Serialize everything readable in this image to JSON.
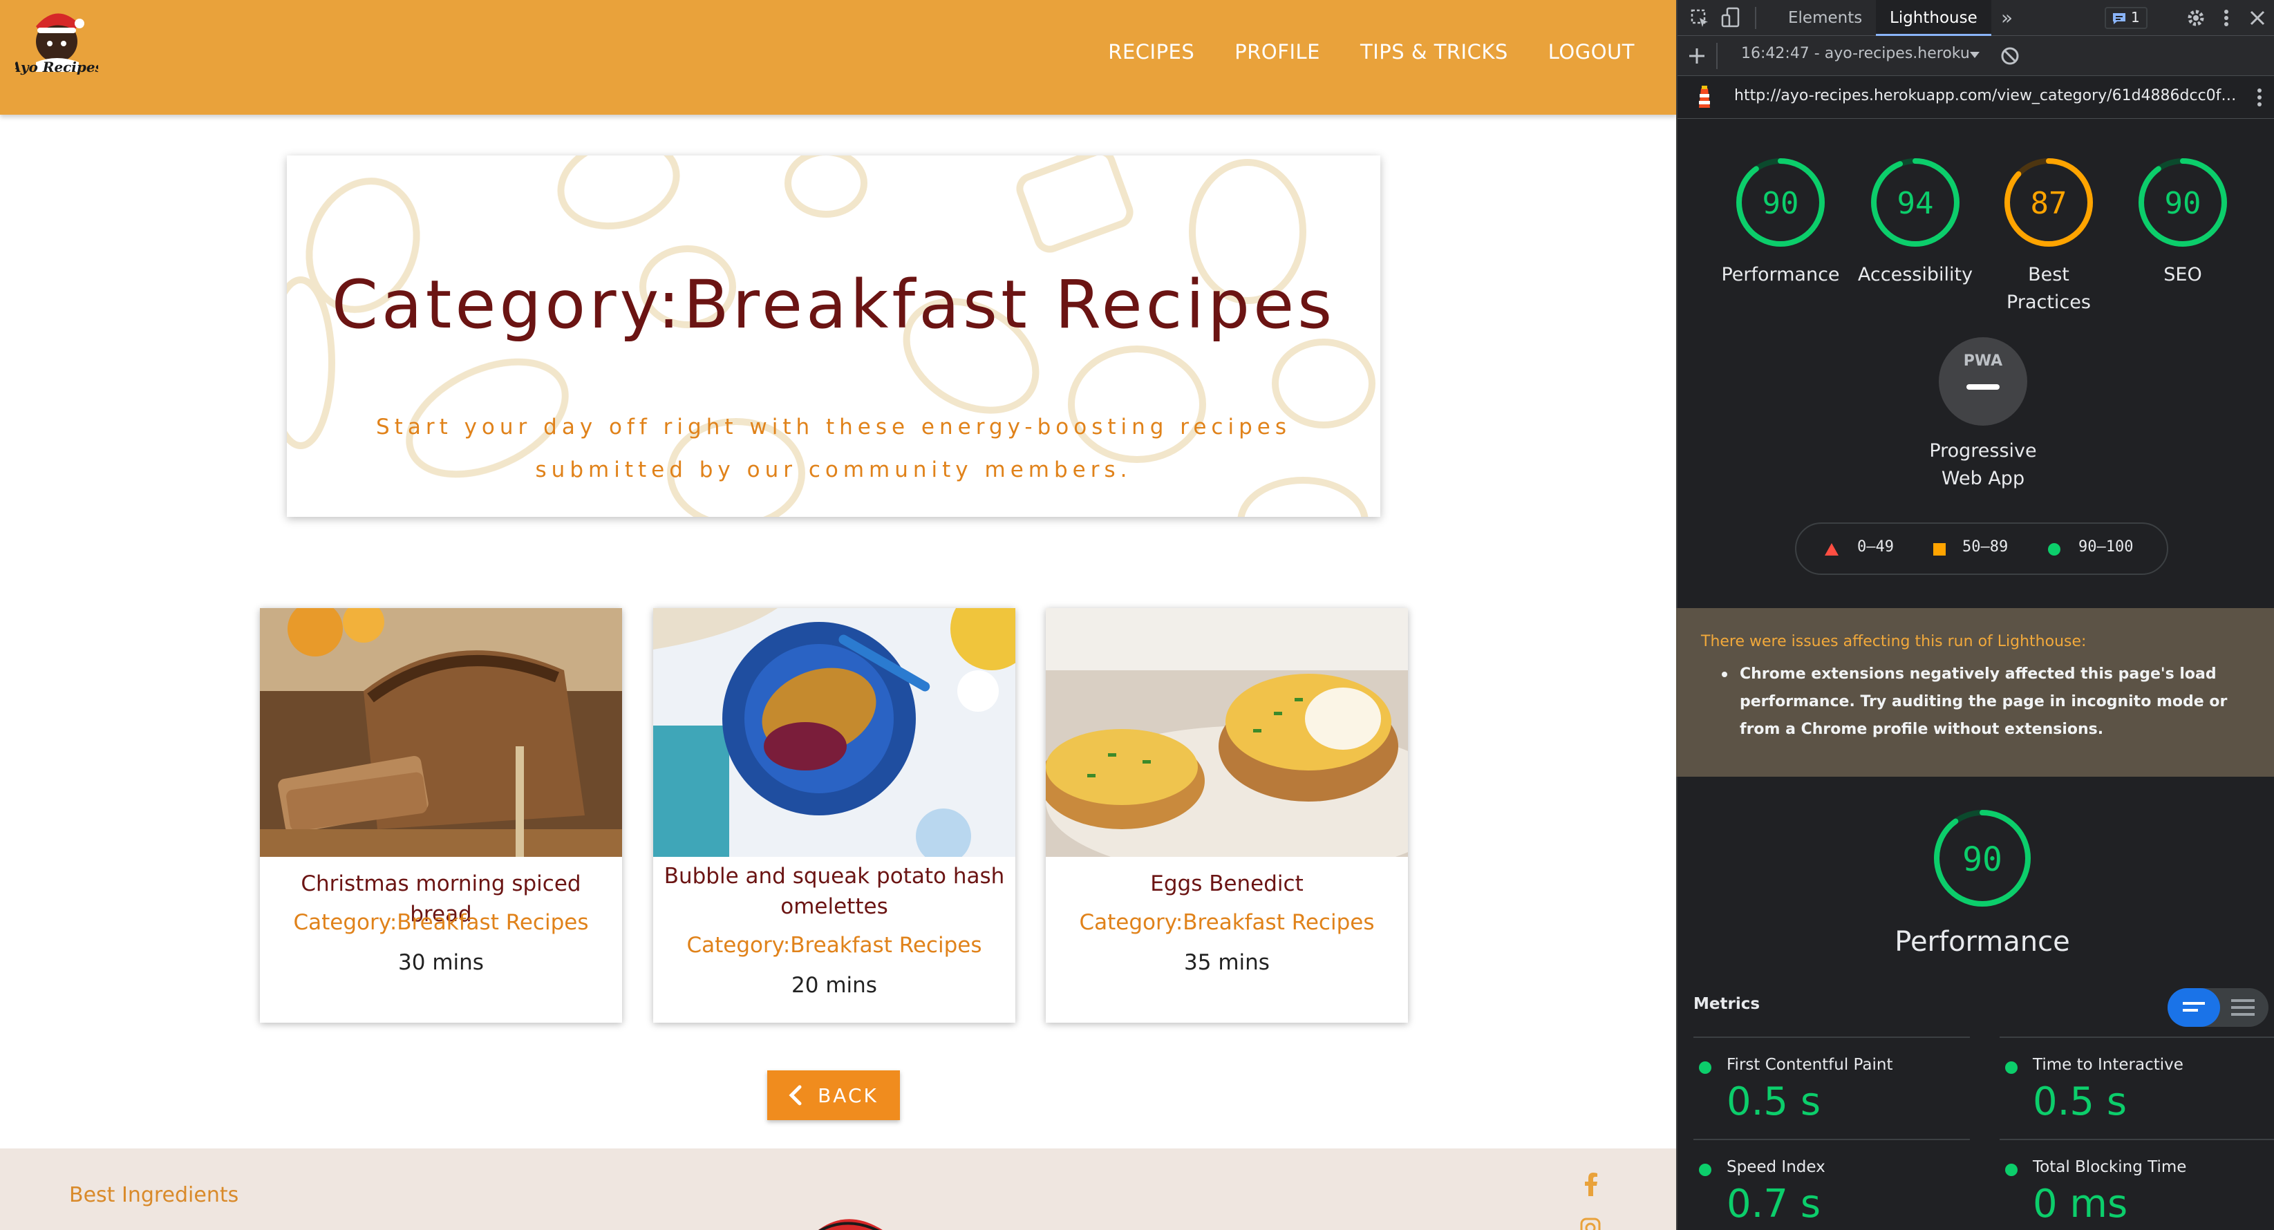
{
  "nav": {
    "links": [
      "RECIPES",
      "PROFILE",
      "TIPS & TRICKS",
      "LOGOUT"
    ]
  },
  "logo": {
    "text": "Ayo Recipes"
  },
  "hero": {
    "title": "Category:Breakfast Recipes",
    "subtitle": "Start your day off right with these energy-boosting recipes submitted by our community members."
  },
  "cards": [
    {
      "title": "Christmas morning spiced bread",
      "category": "Category:Breakfast Recipes",
      "time": "30 mins",
      "image": "bread-photo"
    },
    {
      "title": "Bubble and squeak potato hash omelettes",
      "category": "Category:Breakfast Recipes",
      "time": "20 mins",
      "image": "omelette-photo"
    },
    {
      "title": "Eggs Benedict",
      "category": "Category:Breakfast Recipes",
      "time": "35 mins",
      "image": "eggs-benedict-photo"
    }
  ],
  "back_button": {
    "label": "BACK"
  },
  "footer": {
    "text": "Best Ingredients"
  },
  "devtools": {
    "tabs": [
      "Elements",
      "Lighthouse",
      "»"
    ],
    "issues_count": "1",
    "report_label": "16:42:47 - ayo-recipes.heroku",
    "url": "http://ayo-recipes.herokuapp.com/view_category/61d4886dcc0f…",
    "scores": [
      {
        "label": "Performance",
        "value": "90"
      },
      {
        "label": "Accessibility",
        "value": "94"
      },
      {
        "label": "Best Practices",
        "value": "87"
      },
      {
        "label": "SEO",
        "value": "90"
      }
    ],
    "pwa": {
      "badge": "PWA",
      "label": "Progressive Web App"
    },
    "legend": [
      {
        "range": "0–49",
        "color": "#ff4e42",
        "shape": "triangle"
      },
      {
        "range": "50–89",
        "color": "#ffa400",
        "shape": "square"
      },
      {
        "range": "90–100",
        "color": "#0cce6b",
        "shape": "circle"
      }
    ],
    "warning": {
      "title": "There were issues affecting this run of Lighthouse:",
      "bullet": "Chrome extensions negatively affected this page's load performance. Try auditing the page in incognito mode or from a Chrome profile without extensions."
    },
    "performance": {
      "value": "90",
      "label": "Performance"
    },
    "metrics_header": "Metrics",
    "metrics": [
      {
        "name": "First Contentful Paint",
        "value": "0.5 s"
      },
      {
        "name": "Time to Interactive",
        "value": "0.5 s"
      },
      {
        "name": "Speed Index",
        "value": "0.7 s"
      },
      {
        "name": "Total Blocking Time",
        "value": "0 ms"
      }
    ],
    "colors": {
      "pass": "#0cce6b",
      "average": "#ffa400",
      "fail": "#ff4e42"
    }
  }
}
